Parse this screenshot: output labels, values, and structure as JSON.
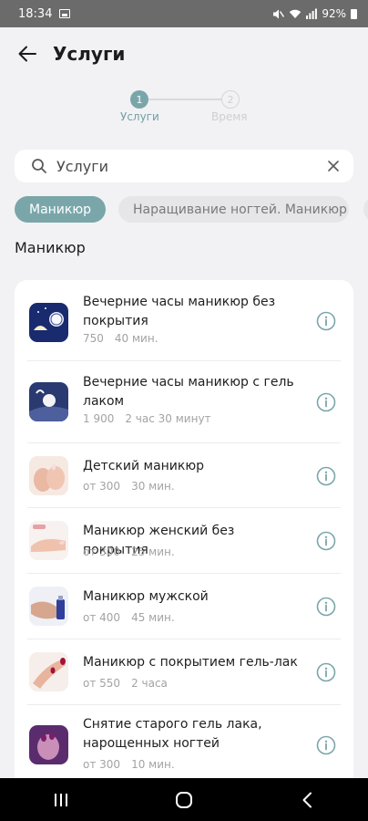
{
  "status_bar": {
    "time": "18:34",
    "battery": "92%",
    "icons": [
      "gallery-icon",
      "mute-icon",
      "wifi-icon",
      "signal-icon",
      "battery-icon"
    ]
  },
  "header": {
    "title": "Услуги",
    "back_icon": "arrow-left-icon"
  },
  "stepper": {
    "steps": [
      {
        "number": "1",
        "label": "Услуги",
        "active": true
      },
      {
        "number": "2",
        "label": "Время",
        "active": false
      }
    ]
  },
  "search": {
    "value": "Услуги",
    "icon": "search-icon",
    "clear_icon": "close-icon"
  },
  "chips": [
    {
      "label": "Маникюр",
      "active": true
    },
    {
      "label": "Наращивание ногтей. Маникюр",
      "active": false
    }
  ],
  "section": {
    "title": "Маникюр"
  },
  "services": [
    {
      "name": "Вечерние часы маникюр без покрытия",
      "price": "750",
      "duration": "40 мин."
    },
    {
      "name": "Вечерние часы маникюр с гель лаком",
      "price": "1 900",
      "duration": "2 час 30 минут"
    },
    {
      "name": "Детский маникюр",
      "price": "от 300",
      "duration": "30 мин."
    },
    {
      "name": "Маникюр  женский без покрытия",
      "price": "от 300",
      "duration": "25 мин."
    },
    {
      "name": "Маникюр мужской",
      "price": "от 400",
      "duration": "45 мин."
    },
    {
      "name": "Маникюр с покрытием гель-лак",
      "price": "от 550",
      "duration": "2 часа"
    },
    {
      "name": "Снятие старого гель лака, нарощенных ногтей",
      "price": "от 300",
      "duration": "10 мин."
    }
  ],
  "colors": {
    "accent": "#7aa6aa",
    "background": "#f2f2f5",
    "card": "#ffffff",
    "muted_text": "#a3a3a3"
  },
  "nav_bar": {
    "icons": [
      "recent-apps-icon",
      "home-icon",
      "back-icon"
    ]
  }
}
